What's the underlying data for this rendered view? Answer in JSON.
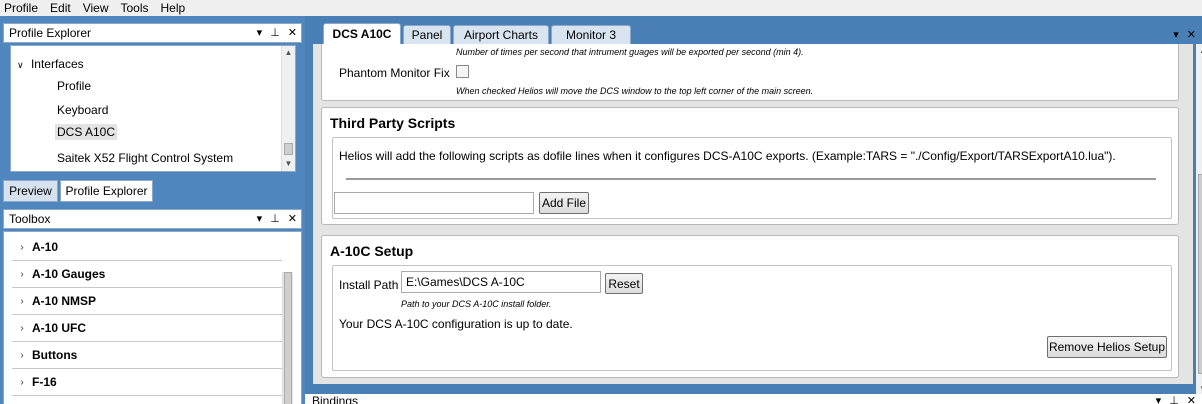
{
  "menu": [
    "Profile",
    "Edit",
    "View",
    "Tools",
    "Help"
  ],
  "profile_explorer": {
    "title": "Profile Explorer",
    "pin": "⭳",
    "close": "✕",
    "tree": {
      "parent": "Interfaces",
      "children": [
        "Profile",
        "Keyboard",
        "DCS A10C",
        "Saitek X52 Flight Control System"
      ],
      "selected": "DCS A10C"
    },
    "tabs": [
      "Preview",
      "Profile Explorer"
    ],
    "active_tab": "Profile Explorer"
  },
  "toolbox": {
    "title": "Toolbox",
    "items": [
      "A-10",
      "A-10 Gauges",
      "A-10 NMSP",
      "A-10 UFC",
      "Buttons",
      "F-16"
    ]
  },
  "doc_tabs": {
    "tabs": [
      "DCS A10C",
      "Panel",
      "Airport Charts",
      "Monitor 3"
    ],
    "active": "DCS A10C"
  },
  "export_section": {
    "freq_note": "Number of times per second that intrument guages will be exported per second (min 4).",
    "phantom_label": "Phantom Monitor Fix",
    "phantom_checked": false,
    "phantom_note": "When checked Helios will move the DCS window to the top left corner of the main screen."
  },
  "third_party": {
    "title": "Third Party Scripts",
    "description": "Helios will add the following scripts as dofile lines when it configures DCS-A10C exports. (Example:TARS = \"./Config/Export/TARSExportA10.lua\").",
    "input_value": "",
    "add_button": "Add File"
  },
  "setup": {
    "title": "A-10C Setup",
    "install_label": "Install Path",
    "install_value": "E:\\Games\\DCS A-10C",
    "reset_button": "Reset",
    "path_note": "Path to your DCS A-10C install folder.",
    "status": "Your DCS A-10C configuration is up to date.",
    "remove_button": "Remove Helios Setup"
  },
  "bindings": {
    "title": "Bindings"
  }
}
